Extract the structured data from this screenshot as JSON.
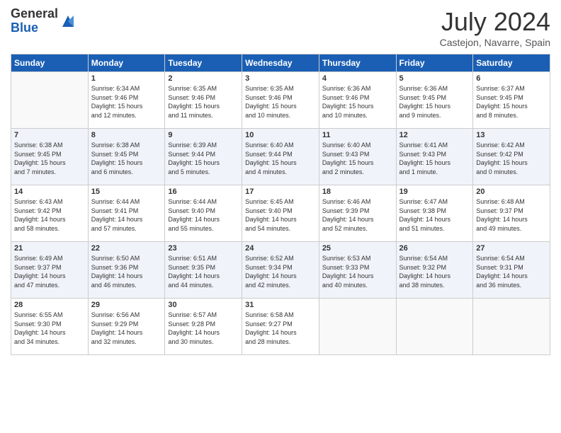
{
  "header": {
    "logo_general": "General",
    "logo_blue": "Blue",
    "month_title": "July 2024",
    "subtitle": "Castejon, Navarre, Spain"
  },
  "days_of_week": [
    "Sunday",
    "Monday",
    "Tuesday",
    "Wednesday",
    "Thursday",
    "Friday",
    "Saturday"
  ],
  "weeks": [
    [
      {
        "day": "",
        "info": ""
      },
      {
        "day": "1",
        "info": "Sunrise: 6:34 AM\nSunset: 9:46 PM\nDaylight: 15 hours\nand 12 minutes."
      },
      {
        "day": "2",
        "info": "Sunrise: 6:35 AM\nSunset: 9:46 PM\nDaylight: 15 hours\nand 11 minutes."
      },
      {
        "day": "3",
        "info": "Sunrise: 6:35 AM\nSunset: 9:46 PM\nDaylight: 15 hours\nand 10 minutes."
      },
      {
        "day": "4",
        "info": "Sunrise: 6:36 AM\nSunset: 9:46 PM\nDaylight: 15 hours\nand 10 minutes."
      },
      {
        "day": "5",
        "info": "Sunrise: 6:36 AM\nSunset: 9:45 PM\nDaylight: 15 hours\nand 9 minutes."
      },
      {
        "day": "6",
        "info": "Sunrise: 6:37 AM\nSunset: 9:45 PM\nDaylight: 15 hours\nand 8 minutes."
      }
    ],
    [
      {
        "day": "7",
        "info": "Sunrise: 6:38 AM\nSunset: 9:45 PM\nDaylight: 15 hours\nand 7 minutes."
      },
      {
        "day": "8",
        "info": "Sunrise: 6:38 AM\nSunset: 9:45 PM\nDaylight: 15 hours\nand 6 minutes."
      },
      {
        "day": "9",
        "info": "Sunrise: 6:39 AM\nSunset: 9:44 PM\nDaylight: 15 hours\nand 5 minutes."
      },
      {
        "day": "10",
        "info": "Sunrise: 6:40 AM\nSunset: 9:44 PM\nDaylight: 15 hours\nand 4 minutes."
      },
      {
        "day": "11",
        "info": "Sunrise: 6:40 AM\nSunset: 9:43 PM\nDaylight: 15 hours\nand 2 minutes."
      },
      {
        "day": "12",
        "info": "Sunrise: 6:41 AM\nSunset: 9:43 PM\nDaylight: 15 hours\nand 1 minute."
      },
      {
        "day": "13",
        "info": "Sunrise: 6:42 AM\nSunset: 9:42 PM\nDaylight: 15 hours\nand 0 minutes."
      }
    ],
    [
      {
        "day": "14",
        "info": "Sunrise: 6:43 AM\nSunset: 9:42 PM\nDaylight: 14 hours\nand 58 minutes."
      },
      {
        "day": "15",
        "info": "Sunrise: 6:44 AM\nSunset: 9:41 PM\nDaylight: 14 hours\nand 57 minutes."
      },
      {
        "day": "16",
        "info": "Sunrise: 6:44 AM\nSunset: 9:40 PM\nDaylight: 14 hours\nand 55 minutes."
      },
      {
        "day": "17",
        "info": "Sunrise: 6:45 AM\nSunset: 9:40 PM\nDaylight: 14 hours\nand 54 minutes."
      },
      {
        "day": "18",
        "info": "Sunrise: 6:46 AM\nSunset: 9:39 PM\nDaylight: 14 hours\nand 52 minutes."
      },
      {
        "day": "19",
        "info": "Sunrise: 6:47 AM\nSunset: 9:38 PM\nDaylight: 14 hours\nand 51 minutes."
      },
      {
        "day": "20",
        "info": "Sunrise: 6:48 AM\nSunset: 9:37 PM\nDaylight: 14 hours\nand 49 minutes."
      }
    ],
    [
      {
        "day": "21",
        "info": "Sunrise: 6:49 AM\nSunset: 9:37 PM\nDaylight: 14 hours\nand 47 minutes."
      },
      {
        "day": "22",
        "info": "Sunrise: 6:50 AM\nSunset: 9:36 PM\nDaylight: 14 hours\nand 46 minutes."
      },
      {
        "day": "23",
        "info": "Sunrise: 6:51 AM\nSunset: 9:35 PM\nDaylight: 14 hours\nand 44 minutes."
      },
      {
        "day": "24",
        "info": "Sunrise: 6:52 AM\nSunset: 9:34 PM\nDaylight: 14 hours\nand 42 minutes."
      },
      {
        "day": "25",
        "info": "Sunrise: 6:53 AM\nSunset: 9:33 PM\nDaylight: 14 hours\nand 40 minutes."
      },
      {
        "day": "26",
        "info": "Sunrise: 6:54 AM\nSunset: 9:32 PM\nDaylight: 14 hours\nand 38 minutes."
      },
      {
        "day": "27",
        "info": "Sunrise: 6:54 AM\nSunset: 9:31 PM\nDaylight: 14 hours\nand 36 minutes."
      }
    ],
    [
      {
        "day": "28",
        "info": "Sunrise: 6:55 AM\nSunset: 9:30 PM\nDaylight: 14 hours\nand 34 minutes."
      },
      {
        "day": "29",
        "info": "Sunrise: 6:56 AM\nSunset: 9:29 PM\nDaylight: 14 hours\nand 32 minutes."
      },
      {
        "day": "30",
        "info": "Sunrise: 6:57 AM\nSunset: 9:28 PM\nDaylight: 14 hours\nand 30 minutes."
      },
      {
        "day": "31",
        "info": "Sunrise: 6:58 AM\nSunset: 9:27 PM\nDaylight: 14 hours\nand 28 minutes."
      },
      {
        "day": "",
        "info": ""
      },
      {
        "day": "",
        "info": ""
      },
      {
        "day": "",
        "info": ""
      }
    ]
  ]
}
